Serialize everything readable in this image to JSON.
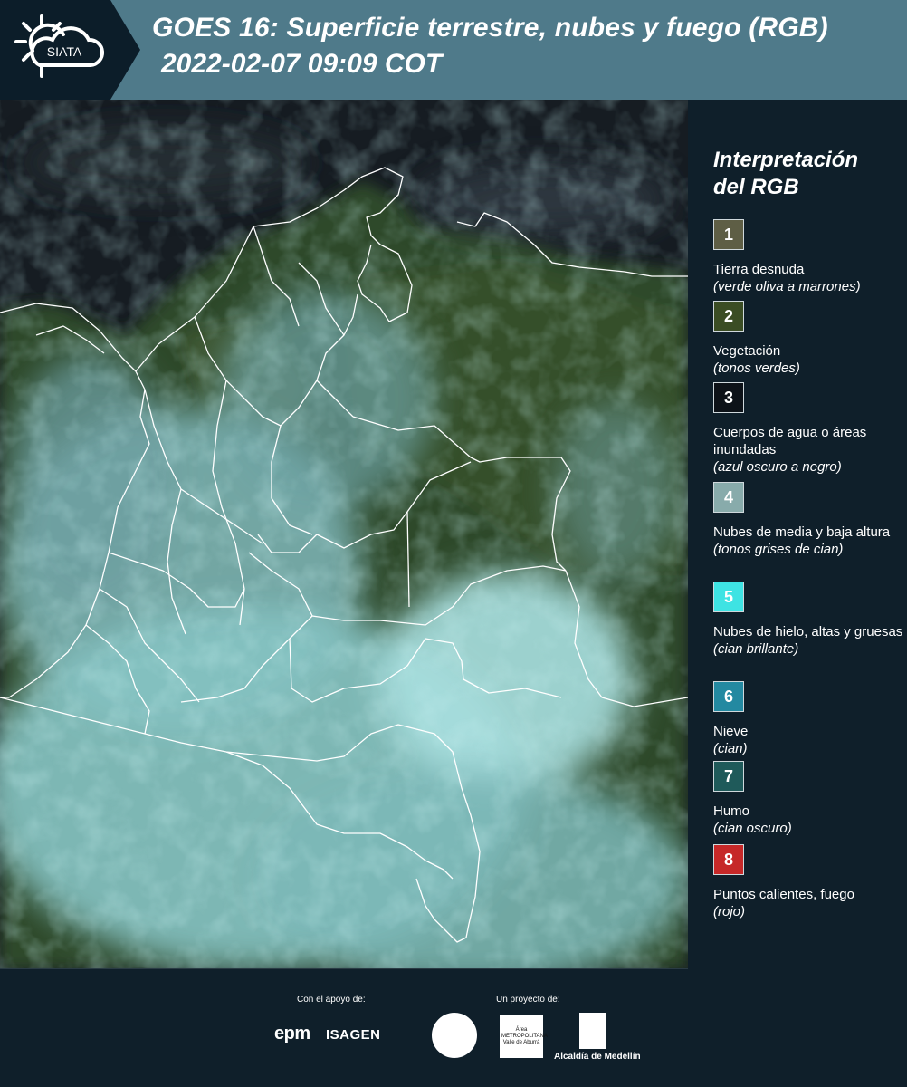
{
  "header": {
    "logo_text": "SIATA",
    "title_line1": "GOES 16: Superficie terrestre, nubes y fuego (RGB)",
    "title_line2": "2022-02-07 09:09 COT"
  },
  "legend": {
    "title_line1": "Interpretación",
    "title_line2": "del RGB",
    "items": [
      {
        "number": "1",
        "label": "Tierra desnuda",
        "sub": "(verde oliva a marrones)",
        "color": "#5e5e45"
      },
      {
        "number": "2",
        "label": "Vegetación",
        "sub": "(tonos verdes)",
        "color": "#3b4d24"
      },
      {
        "number": "3",
        "label": "Cuerpos de agua o áreas inundadas",
        "sub": "(azul oscuro a negro)",
        "color": "#0d1218"
      },
      {
        "number": "4",
        "label": "Nubes de media y baja altura",
        "sub": "(tonos grises de cian)",
        "color": "#88abab"
      },
      {
        "number": "5",
        "label": "Nubes de hielo, altas y gruesas",
        "sub": "(cian brillante)",
        "color": "#3ee3e3"
      },
      {
        "number": "6",
        "label": "Nieve",
        "sub": "(cian)",
        "color": "#2389a1"
      },
      {
        "number": "7",
        "label": "Humo",
        "sub": "(cian oscuro)",
        "color": "#1f5a5a"
      },
      {
        "number": "8",
        "label": "Puntos calientes, fuego",
        "sub": "(rojo)",
        "color": "#c62828"
      }
    ]
  },
  "footer": {
    "support_label": "Con el apoyo de:",
    "project_label": "Un proyecto de:",
    "sponsor_1": "epm",
    "sponsor_2": "ISAGEN",
    "area_logo_text": "Área METROPOLITANA Valle de Aburrá",
    "alcaldia": "Alcaldía de Medellín"
  }
}
